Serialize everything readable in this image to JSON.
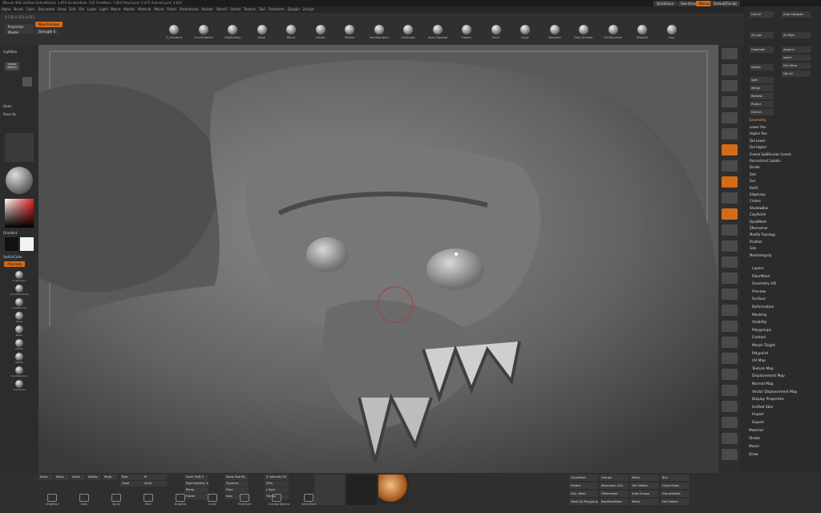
{
  "titlebar": {
    "text": "ZBrush 4R6  Untitled   ActivePoints: 1,874   ScratchDisk: 532   FreeMem: 7,820   PolyCount: 2.472   ActiveCount: 4.832"
  },
  "menu": {
    "items": [
      "Alpha",
      "Brush",
      "Color",
      "Document",
      "Draw",
      "Edit",
      "File",
      "Layer",
      "Light",
      "Macro",
      "Marker",
      "Material",
      "Movie",
      "Picker",
      "Preferences",
      "Render",
      "Stencil",
      "Stroke",
      "Texture",
      "Tool",
      "Transform",
      "Zplugin",
      "Zscript"
    ]
  },
  "topbar": {
    "quicksave": "QuickSave",
    "see_through": "See-through 0",
    "menus": "Menus",
    "default_script": "DefaultZScript"
  },
  "left": {
    "projection_master": "Projection Master",
    "lightbox": "LightBox",
    "quick_sketch": "Quick Sketch",
    "open": "Open",
    "save_as": "Save As",
    "gradient": "Gradient",
    "switch_color": "SwitchColor",
    "alternate": "Alternate",
    "coords": "0.135,0.352,0.553",
    "now_preview": "Now Preview",
    "strength": "Strength 0"
  },
  "brushes": [
    "Z_Standard",
    "CurveTubeSnap",
    "ClayBuildup",
    "Move",
    "Blend",
    "Inflate",
    "hPolish",
    "DamStandard",
    "ClayTubes",
    "Move Topological",
    "Flatten",
    "Pinch",
    "Layer",
    "Standard",
    "Dam_Standard",
    "TrimDynamic",
    "hPolish2",
    "Clay"
  ],
  "right_palette": {
    "tool_items": [
      "List All",
      "Auto Collapse",
      "All Low",
      "All High",
      "Duplicate",
      "Append",
      "Insert",
      "Delete",
      "Del Other",
      "Del All",
      "Split",
      "Merge",
      "Remesh",
      "Project",
      "Extract"
    ],
    "geometry": "Geometry",
    "geom_items": [
      "Lower Res",
      "Higher Res",
      "Del Lower",
      "Del Higher",
      "Freeze SubDivision Levels",
      "Reconstruct Subdiv",
      "Divide",
      "Smt",
      "Suv",
      "ReUV",
      "EdgeLoop",
      "Crease",
      "ShadowBox",
      "ClayPolish",
      "DynaMesh",
      "ZRemesher",
      "Modify Topology",
      "Position",
      "Size",
      "MeshIntegrity"
    ],
    "subpalettes": [
      "Layers",
      "FiberMesh",
      "Geometry HD",
      "Preview",
      "Surface",
      "Deformation",
      "Masking",
      "Visibility",
      "Polygroups",
      "Contact",
      "Morph Target",
      "Polypaint",
      "UV Map",
      "Texture Map",
      "Displacement Map",
      "Normal Map",
      "Vector Displacement Map",
      "Display Properties",
      "Unified Skin",
      "Import",
      "Export"
    ],
    "trays": [
      "Material",
      "Stroke",
      "Movie",
      "Draw"
    ]
  },
  "bottom": {
    "buttons": [
      "Draw",
      "Move",
      "Scale",
      "Rotate",
      "Mrgb",
      "Rgb",
      "M",
      "Zadd",
      "Zsub",
      "Focal Shift 0",
      "Draw Size 64",
      "Z Intensity 45",
      "Rgb Intensity 100",
      "Dynamic",
      "SDiv",
      "Persp",
      "Floor",
      "L.Sym",
      "Frame",
      "Solo",
      "Transp"
    ],
    "strokes": [
      "DragRect",
      "Dots",
      "Spray",
      "Rect",
      "DragDot",
      "Curve",
      "FreeHand",
      "StandardAlpha",
      "SelectRect"
    ],
    "right_buttons": [
      "DynaMesh",
      "Groups",
      "Polish",
      "Blur",
      "Project",
      "Resolution 104",
      "Del Hidden",
      "Close Holes",
      "Sub. Mesh",
      "ZRemesher",
      "Auto Groups",
      "GroupVisible",
      "Mask By Polygroups 0",
      "BackfaceMask",
      "Mirror",
      "Del Hidden"
    ]
  },
  "colors": {
    "accent": "#d56a17",
    "panel": "#2b2b2b",
    "viewport": "#5b5b5b"
  }
}
